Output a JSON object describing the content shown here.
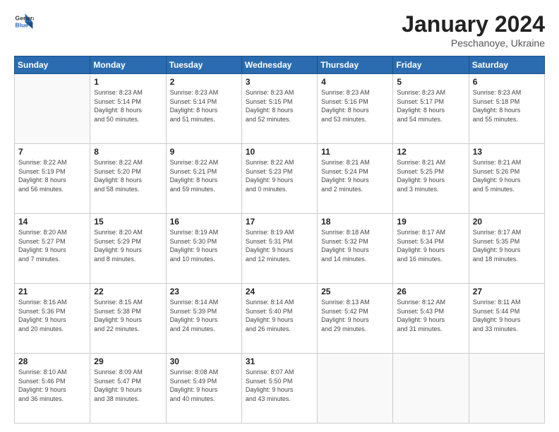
{
  "header": {
    "logo_general": "General",
    "logo_blue": "Blue",
    "title": "January 2024",
    "location": "Peschanoye, Ukraine"
  },
  "weekdays": [
    "Sunday",
    "Monday",
    "Tuesday",
    "Wednesday",
    "Thursday",
    "Friday",
    "Saturday"
  ],
  "weeks": [
    [
      {
        "day": "",
        "info": ""
      },
      {
        "day": "1",
        "info": "Sunrise: 8:23 AM\nSunset: 5:14 PM\nDaylight: 8 hours\nand 50 minutes."
      },
      {
        "day": "2",
        "info": "Sunrise: 8:23 AM\nSunset: 5:14 PM\nDaylight: 8 hours\nand 51 minutes."
      },
      {
        "day": "3",
        "info": "Sunrise: 8:23 AM\nSunset: 5:15 PM\nDaylight: 8 hours\nand 52 minutes."
      },
      {
        "day": "4",
        "info": "Sunrise: 8:23 AM\nSunset: 5:16 PM\nDaylight: 8 hours\nand 53 minutes."
      },
      {
        "day": "5",
        "info": "Sunrise: 8:23 AM\nSunset: 5:17 PM\nDaylight: 8 hours\nand 54 minutes."
      },
      {
        "day": "6",
        "info": "Sunrise: 8:23 AM\nSunset: 5:18 PM\nDaylight: 8 hours\nand 55 minutes."
      }
    ],
    [
      {
        "day": "7",
        "info": "Sunrise: 8:22 AM\nSunset: 5:19 PM\nDaylight: 8 hours\nand 56 minutes."
      },
      {
        "day": "8",
        "info": "Sunrise: 8:22 AM\nSunset: 5:20 PM\nDaylight: 8 hours\nand 58 minutes."
      },
      {
        "day": "9",
        "info": "Sunrise: 8:22 AM\nSunset: 5:21 PM\nDaylight: 8 hours\nand 59 minutes."
      },
      {
        "day": "10",
        "info": "Sunrise: 8:22 AM\nSunset: 5:23 PM\nDaylight: 9 hours\nand 0 minutes."
      },
      {
        "day": "11",
        "info": "Sunrise: 8:21 AM\nSunset: 5:24 PM\nDaylight: 9 hours\nand 2 minutes."
      },
      {
        "day": "12",
        "info": "Sunrise: 8:21 AM\nSunset: 5:25 PM\nDaylight: 9 hours\nand 3 minutes."
      },
      {
        "day": "13",
        "info": "Sunrise: 8:21 AM\nSunset: 5:26 PM\nDaylight: 9 hours\nand 5 minutes."
      }
    ],
    [
      {
        "day": "14",
        "info": "Sunrise: 8:20 AM\nSunset: 5:27 PM\nDaylight: 9 hours\nand 7 minutes."
      },
      {
        "day": "15",
        "info": "Sunrise: 8:20 AM\nSunset: 5:29 PM\nDaylight: 9 hours\nand 8 minutes."
      },
      {
        "day": "16",
        "info": "Sunrise: 8:19 AM\nSunset: 5:30 PM\nDaylight: 9 hours\nand 10 minutes."
      },
      {
        "day": "17",
        "info": "Sunrise: 8:19 AM\nSunset: 5:31 PM\nDaylight: 9 hours\nand 12 minutes."
      },
      {
        "day": "18",
        "info": "Sunrise: 8:18 AM\nSunset: 5:32 PM\nDaylight: 9 hours\nand 14 minutes."
      },
      {
        "day": "19",
        "info": "Sunrise: 8:17 AM\nSunset: 5:34 PM\nDaylight: 9 hours\nand 16 minutes."
      },
      {
        "day": "20",
        "info": "Sunrise: 8:17 AM\nSunset: 5:35 PM\nDaylight: 9 hours\nand 18 minutes."
      }
    ],
    [
      {
        "day": "21",
        "info": "Sunrise: 8:16 AM\nSunset: 5:36 PM\nDaylight: 9 hours\nand 20 minutes."
      },
      {
        "day": "22",
        "info": "Sunrise: 8:15 AM\nSunset: 5:38 PM\nDaylight: 9 hours\nand 22 minutes."
      },
      {
        "day": "23",
        "info": "Sunrise: 8:14 AM\nSunset: 5:39 PM\nDaylight: 9 hours\nand 24 minutes."
      },
      {
        "day": "24",
        "info": "Sunrise: 8:14 AM\nSunset: 5:40 PM\nDaylight: 9 hours\nand 26 minutes."
      },
      {
        "day": "25",
        "info": "Sunrise: 8:13 AM\nSunset: 5:42 PM\nDaylight: 9 hours\nand 29 minutes."
      },
      {
        "day": "26",
        "info": "Sunrise: 8:12 AM\nSunset: 5:43 PM\nDaylight: 9 hours\nand 31 minutes."
      },
      {
        "day": "27",
        "info": "Sunrise: 8:11 AM\nSunset: 5:44 PM\nDaylight: 9 hours\nand 33 minutes."
      }
    ],
    [
      {
        "day": "28",
        "info": "Sunrise: 8:10 AM\nSunset: 5:46 PM\nDaylight: 9 hours\nand 36 minutes."
      },
      {
        "day": "29",
        "info": "Sunrise: 8:09 AM\nSunset: 5:47 PM\nDaylight: 9 hours\nand 38 minutes."
      },
      {
        "day": "30",
        "info": "Sunrise: 8:08 AM\nSunset: 5:49 PM\nDaylight: 9 hours\nand 40 minutes."
      },
      {
        "day": "31",
        "info": "Sunrise: 8:07 AM\nSunset: 5:50 PM\nDaylight: 9 hours\nand 43 minutes."
      },
      {
        "day": "",
        "info": ""
      },
      {
        "day": "",
        "info": ""
      },
      {
        "day": "",
        "info": ""
      }
    ]
  ]
}
